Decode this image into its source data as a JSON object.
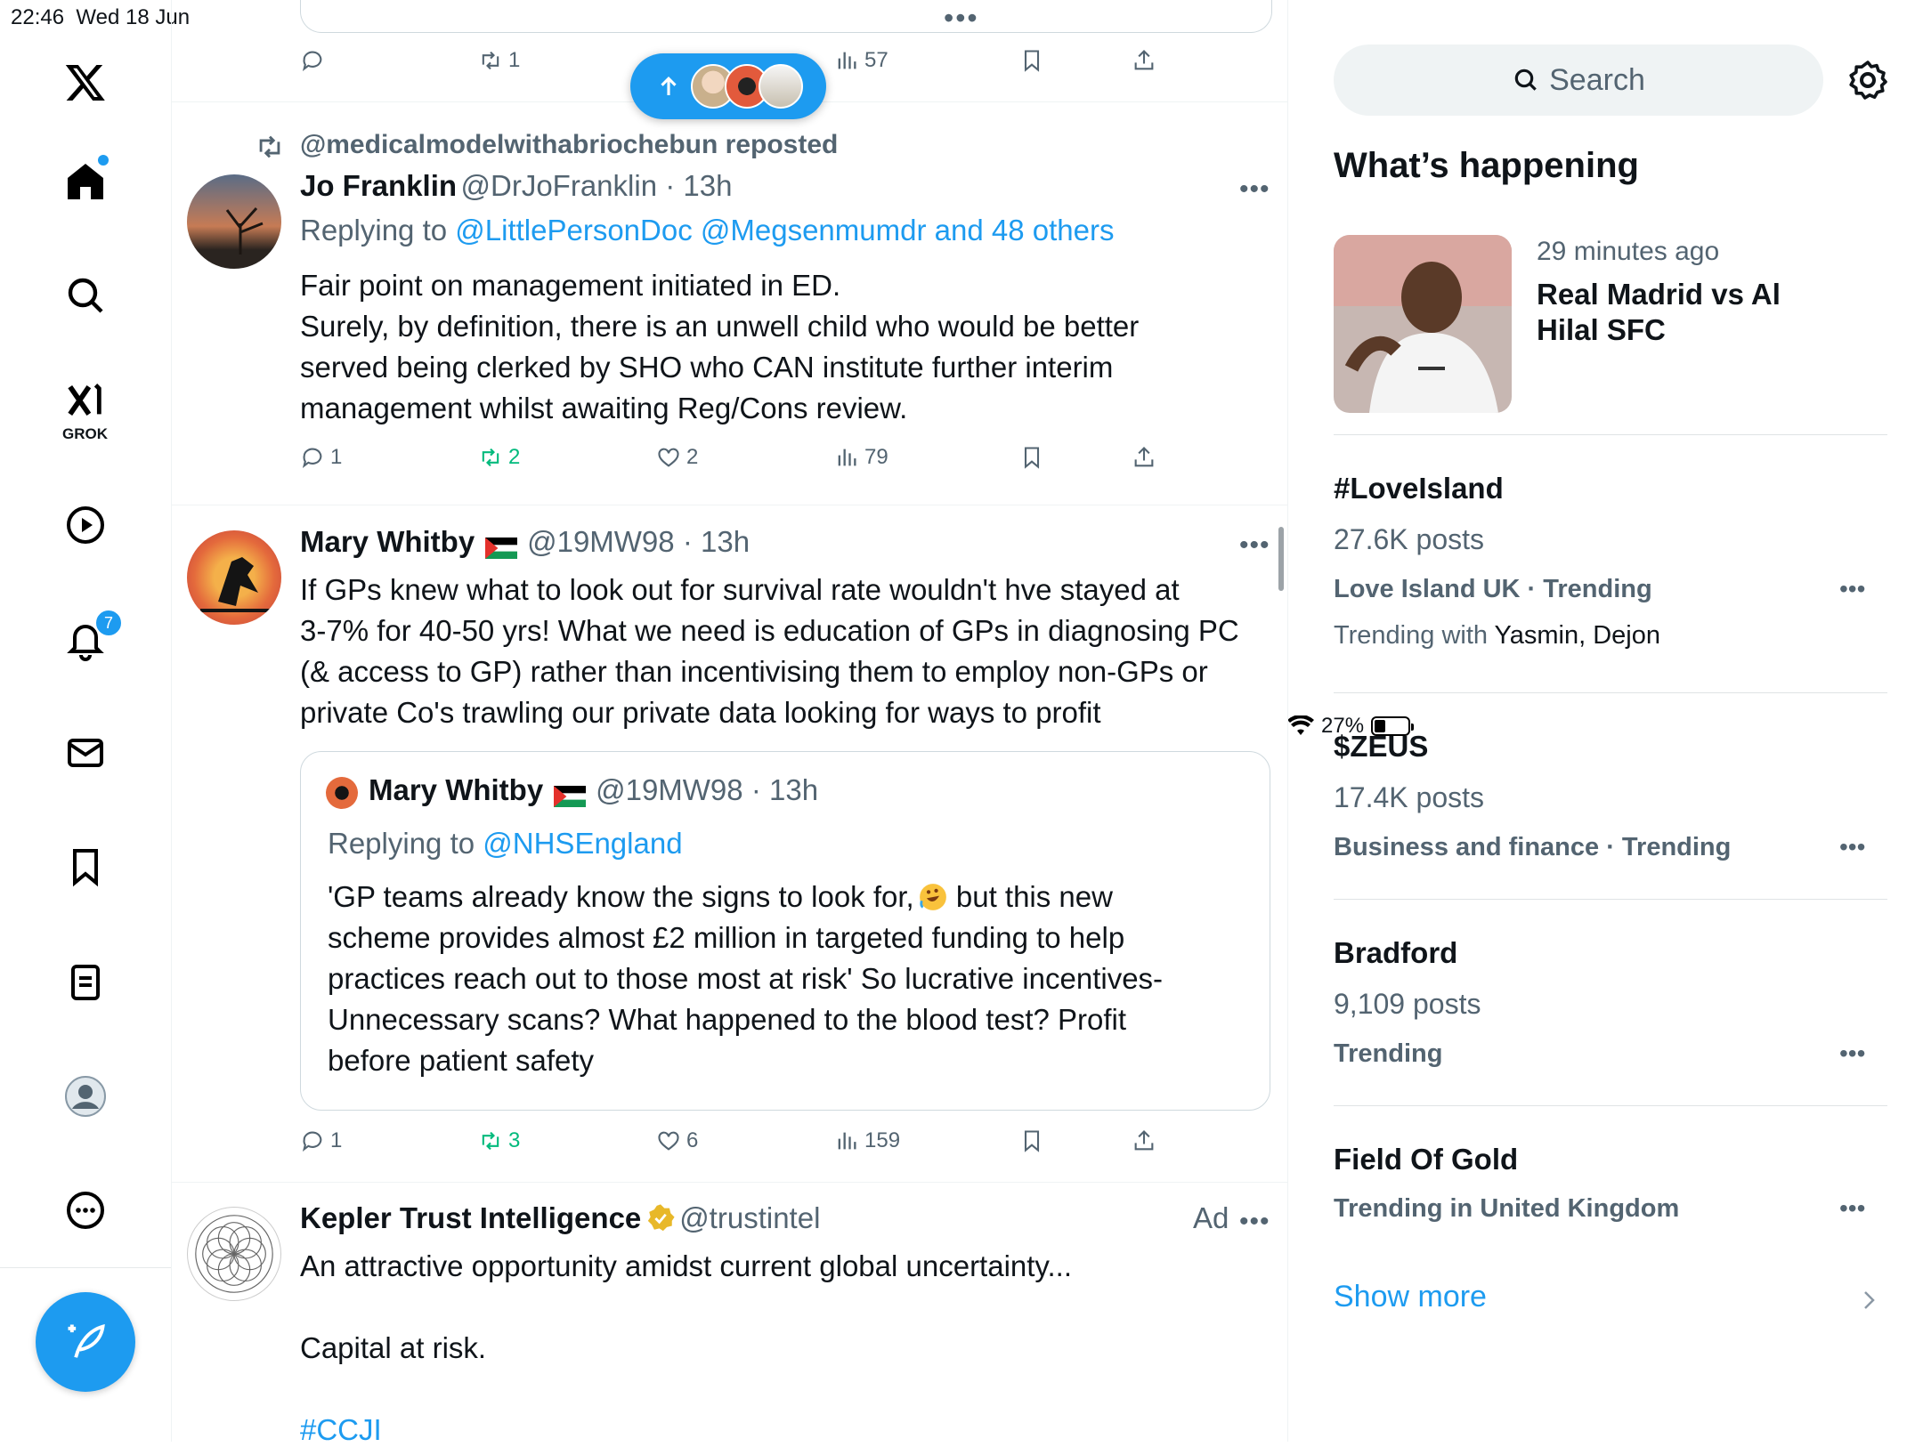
{
  "status": {
    "time": "22:46",
    "date": "Wed 18 Jun",
    "battery": "27%"
  },
  "nav": {
    "grok_label": "GROK",
    "notifications_badge": "7"
  },
  "feed": {
    "prev_post": {
      "retweets": "1",
      "views": "57"
    },
    "post1": {
      "reposted_by": "@medicalmodelwithabriochebun reposted",
      "name": "Jo Franklin",
      "handle": "@DrJoFranklin",
      "time": "13h",
      "replying_prefix": "Replying to ",
      "replying_to": "@LittlePersonDoc @Megsenmumdr and 48 others",
      "lines": [
        "Fair point on management initiated in ED.",
        "Surely, by definition, there is an unwell child who would be better",
        "served being clerked by SHO who CAN institute further interim",
        "management whilst awaiting Reg/Cons review."
      ],
      "replies": "1",
      "retweets": "2",
      "likes": "2",
      "views": "79"
    },
    "post2": {
      "name": "Mary Whitby",
      "handle": "@19MW98",
      "time": "13h",
      "lines": [
        "If GPs knew what to look out for survival rate wouldn't hve stayed at",
        "3-7% for 40-50 yrs! What we need is education of GPs in diagnosing PC",
        "(& access to GP) rather than incentivising them to employ non-GPs or",
        "private Co's trawling our private data looking for ways to profit"
      ],
      "quote": {
        "name": "Mary Whitby",
        "handle": "@19MW98",
        "time": "13h",
        "replying_prefix": "Replying to ",
        "replying_to": "@NHSEngland",
        "line1a": "'GP teams already know the signs to look for,",
        "line1b": " but this new",
        "lines": [
          "scheme provides almost £2 million in targeted funding to help",
          "practices reach out to those most at risk' So lucrative incentives-",
          "Unnecessary scans? What happened to the blood test? Profit",
          "before patient safety"
        ]
      },
      "replies": "1",
      "retweets": "3",
      "likes": "6",
      "views": "159"
    },
    "post3": {
      "name": "Kepler Trust Intelligence",
      "handle": "@trustintel",
      "ad_label": "Ad",
      "line1": "An attractive opportunity amidst current global uncertainty...",
      "line2": "Capital at risk.",
      "hashtag": "#CCJI"
    }
  },
  "sidebar": {
    "search_placeholder": "Search",
    "title": "What’s happening",
    "featured": {
      "time": "29 minutes ago",
      "title_l1": "Real Madrid vs Al",
      "title_l2": "Hilal SFC"
    },
    "trends": [
      {
        "name": "#LoveIsland",
        "posts": "27.6K posts",
        "meta": "Love Island UK · Trending",
        "with_prefix": "Trending with ",
        "with_names": "Yasmin, Dejon"
      },
      {
        "name": "$ZEUS",
        "posts": "17.4K posts",
        "meta": "Business and finance · Trending"
      },
      {
        "name": "Bradford",
        "posts": "9,109 posts",
        "meta": "Trending"
      },
      {
        "name": "Field Of Gold",
        "meta": "Trending in United Kingdom"
      }
    ],
    "show_more": "Show more"
  },
  "colors": {
    "accent": "#1d9bf0",
    "retweet_green": "#00ba7c",
    "muted": "#536471"
  }
}
